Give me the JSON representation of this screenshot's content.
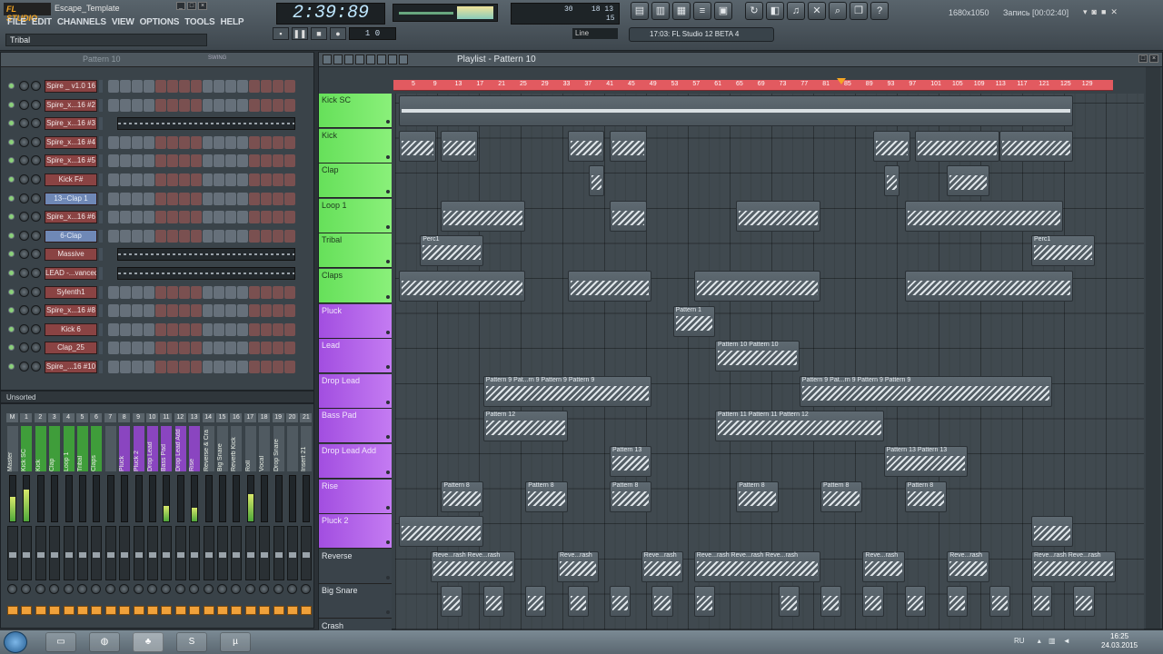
{
  "app": {
    "logo": "FL STUDIO",
    "window_title": "Escape_Template",
    "hint": "Tribal"
  },
  "menu": [
    "FILE",
    "EDIT",
    "CHANNELS",
    "VIEW",
    "OPTIONS",
    "TOOLS",
    "HELP"
  ],
  "transport": {
    "time": "2:39:89",
    "pattern_label": "Pattern 10",
    "pattern_readout": "1 0",
    "snap": "Line"
  },
  "cpu": {
    "cpu_val": "30",
    "mem_val": "18 13",
    "poly_val": "15"
  },
  "news": "17:03: FL Studio 12 BETA 4",
  "recorder": {
    "resolution": "1680x1050",
    "recording": "Запись [00:02:40]"
  },
  "rack": {
    "title": "Pattern 10",
    "swing": "SWING",
    "channels": [
      {
        "name": "Spire _ v1.0 16",
        "style": "red",
        "mode": "steps"
      },
      {
        "name": "Spire_x...16 #2",
        "style": "red",
        "mode": "steps"
      },
      {
        "name": "Spire_x...16 #3",
        "style": "red",
        "mode": "roll"
      },
      {
        "name": "Spire_x...16 #4",
        "style": "red",
        "mode": "steps"
      },
      {
        "name": "Spire_x...16 #5",
        "style": "red",
        "mode": "steps"
      },
      {
        "name": "Kick F#",
        "style": "red",
        "mode": "steps"
      },
      {
        "name": "13--Clap 1",
        "style": "blue",
        "mode": "steps"
      },
      {
        "name": "Spire_x...16 #6",
        "style": "red",
        "mode": "steps"
      },
      {
        "name": "6-Clap",
        "style": "blue",
        "mode": "steps"
      },
      {
        "name": "Massive",
        "style": "red",
        "mode": "roll"
      },
      {
        "name": "LEAD -...vanced",
        "style": "red",
        "mode": "roll"
      },
      {
        "name": "Sylenth1",
        "style": "red",
        "mode": "steps"
      },
      {
        "name": "Spire_x...16 #8",
        "style": "red",
        "mode": "steps"
      },
      {
        "name": "Kick 6",
        "style": "red",
        "mode": "steps"
      },
      {
        "name": "Clap_25",
        "style": "red",
        "mode": "steps"
      },
      {
        "name": "Spire_...16 #10",
        "style": "red",
        "mode": "steps"
      }
    ],
    "filter": "Unsorted"
  },
  "mixer": {
    "tracks": [
      {
        "num": "M",
        "label": "Master",
        "c": "d",
        "level": 0.55
      },
      {
        "num": "1",
        "label": "Kick SC",
        "c": "g",
        "level": 0.7
      },
      {
        "num": "2",
        "label": "Kick",
        "c": "g",
        "level": 0.0
      },
      {
        "num": "3",
        "label": "Clap",
        "c": "g",
        "level": 0.0
      },
      {
        "num": "4",
        "label": "Loop 1",
        "c": "g",
        "level": 0.0
      },
      {
        "num": "5",
        "label": "Tribal",
        "c": "g",
        "level": 0.0
      },
      {
        "num": "6",
        "label": "Claps",
        "c": "g",
        "level": 0.0
      },
      {
        "num": "7",
        "label": "",
        "c": "d",
        "level": 0.0
      },
      {
        "num": "8",
        "label": "Pluck",
        "c": "p",
        "level": 0.0
      },
      {
        "num": "9",
        "label": "Pluck 2",
        "c": "p",
        "level": 0.0
      },
      {
        "num": "10",
        "label": "Drop Lead",
        "c": "p",
        "level": 0.0
      },
      {
        "num": "11",
        "label": "Bass Pad",
        "c": "p",
        "level": 0.35
      },
      {
        "num": "12",
        "label": "Drop Lead Add",
        "c": "p",
        "level": 0.0
      },
      {
        "num": "13",
        "label": "Rise",
        "c": "p",
        "level": 0.3
      },
      {
        "num": "14",
        "label": "Reverse & Cra",
        "c": "d",
        "level": 0.0
      },
      {
        "num": "15",
        "label": "Big Snare",
        "c": "d",
        "level": 0.0
      },
      {
        "num": "16",
        "label": "Reverb Kick",
        "c": "d",
        "level": 0.0
      },
      {
        "num": "17",
        "label": "Roll",
        "c": "d",
        "level": 0.6
      },
      {
        "num": "18",
        "label": "Vocal",
        "c": "d",
        "level": 0.0
      },
      {
        "num": "19",
        "label": "Drop Snare",
        "c": "d",
        "level": 0.0
      },
      {
        "num": "20",
        "label": "",
        "c": "d",
        "level": 0.0
      },
      {
        "num": "21",
        "label": "Insert 21",
        "c": "d",
        "level": 0.0
      }
    ]
  },
  "playlist": {
    "title": "Playlist - Pattern 10",
    "ruler": [
      "5",
      "9",
      "13",
      "17",
      "21",
      "25",
      "29",
      "33",
      "37",
      "41",
      "45",
      "49",
      "53",
      "57",
      "61",
      "65",
      "69",
      "73",
      "77",
      "81",
      "85",
      "89",
      "93",
      "97",
      "101",
      "105",
      "109",
      "113",
      "117",
      "121",
      "125",
      "129"
    ],
    "tracks": [
      {
        "name": "Kick SC",
        "c": "g"
      },
      {
        "name": "Kick",
        "c": "g"
      },
      {
        "name": "Clap",
        "c": "g"
      },
      {
        "name": "Loop 1",
        "c": "g"
      },
      {
        "name": "Tribal",
        "c": "g"
      },
      {
        "name": "Claps",
        "c": "g"
      },
      {
        "name": "Pluck",
        "c": "p"
      },
      {
        "name": "Lead",
        "c": "p"
      },
      {
        "name": "Drop Lead",
        "c": "p"
      },
      {
        "name": "Bass Pad",
        "c": "p"
      },
      {
        "name": "Drop Lead Add",
        "c": "p"
      },
      {
        "name": "Rise",
        "c": "p"
      },
      {
        "name": "Pluck 2",
        "c": "p"
      },
      {
        "name": "Reverse",
        "c": "d"
      },
      {
        "name": "Big Snare",
        "c": "d"
      },
      {
        "name": "Crash",
        "c": "d"
      }
    ],
    "clips": [
      {
        "t": 0,
        "s": 0,
        "l": 128,
        "cap": "",
        "k": "plain"
      },
      {
        "t": 1,
        "s": 0,
        "l": 7,
        "cap": ""
      },
      {
        "t": 1,
        "s": 8,
        "l": 7,
        "cap": ""
      },
      {
        "t": 1,
        "s": 32,
        "l": 7,
        "cap": ""
      },
      {
        "t": 1,
        "s": 40,
        "l": 7,
        "cap": ""
      },
      {
        "t": 1,
        "s": 90,
        "l": 7,
        "cap": ""
      },
      {
        "t": 1,
        "s": 98,
        "l": 16,
        "cap": ""
      },
      {
        "t": 1,
        "s": 114,
        "l": 14,
        "cap": ""
      },
      {
        "t": 2,
        "s": 36,
        "l": 3,
        "cap": ""
      },
      {
        "t": 2,
        "s": 92,
        "l": 3,
        "cap": ""
      },
      {
        "t": 2,
        "s": 104,
        "l": 8,
        "cap": ""
      },
      {
        "t": 3,
        "s": 8,
        "l": 16,
        "cap": ""
      },
      {
        "t": 3,
        "s": 40,
        "l": 7,
        "cap": ""
      },
      {
        "t": 3,
        "s": 64,
        "l": 16,
        "cap": ""
      },
      {
        "t": 3,
        "s": 96,
        "l": 30,
        "cap": ""
      },
      {
        "t": 4,
        "s": 4,
        "l": 12,
        "cap": "Perc1"
      },
      {
        "t": 4,
        "s": 120,
        "l": 12,
        "cap": "Perc1"
      },
      {
        "t": 5,
        "s": 0,
        "l": 24,
        "cap": ""
      },
      {
        "t": 5,
        "s": 32,
        "l": 16,
        "cap": ""
      },
      {
        "t": 5,
        "s": 56,
        "l": 24,
        "cap": ""
      },
      {
        "t": 5,
        "s": 96,
        "l": 32,
        "cap": ""
      },
      {
        "t": 6,
        "s": 52,
        "l": 8,
        "cap": "Pattern 1"
      },
      {
        "t": 7,
        "s": 60,
        "l": 16,
        "cap": "Pattern 10  Pattern 10"
      },
      {
        "t": 8,
        "s": 16,
        "l": 32,
        "cap": "Pattern 9  Pat...rn 9  Pattern 9  Pattern 9"
      },
      {
        "t": 8,
        "s": 76,
        "l": 48,
        "cap": "Pattern 9  Pat...rn 9  Pattern 9  Pattern 9"
      },
      {
        "t": 9,
        "s": 16,
        "l": 16,
        "cap": "Pattern 12"
      },
      {
        "t": 9,
        "s": 60,
        "l": 32,
        "cap": "Pattern 11  Pattern 11  Pattern 12"
      },
      {
        "t": 10,
        "s": 40,
        "l": 8,
        "cap": "Pattern 13"
      },
      {
        "t": 10,
        "s": 92,
        "l": 16,
        "cap": "Pattern 13  Pattern 13"
      },
      {
        "t": 11,
        "s": 8,
        "l": 8,
        "cap": "Pattern 8"
      },
      {
        "t": 11,
        "s": 24,
        "l": 8,
        "cap": "Pattern 8"
      },
      {
        "t": 11,
        "s": 40,
        "l": 8,
        "cap": "Pattern 8"
      },
      {
        "t": 11,
        "s": 64,
        "l": 8,
        "cap": "Pattern 8"
      },
      {
        "t": 11,
        "s": 80,
        "l": 8,
        "cap": "Pattern 8"
      },
      {
        "t": 11,
        "s": 96,
        "l": 8,
        "cap": "Pattern 8"
      },
      {
        "t": 12,
        "s": 0,
        "l": 16,
        "cap": ""
      },
      {
        "t": 12,
        "s": 120,
        "l": 8,
        "cap": ""
      },
      {
        "t": 13,
        "s": 6,
        "l": 16,
        "cap": "Reve...rash  Reve...rash"
      },
      {
        "t": 13,
        "s": 30,
        "l": 8,
        "cap": "Reve...rash"
      },
      {
        "t": 13,
        "s": 46,
        "l": 8,
        "cap": "Reve...rash"
      },
      {
        "t": 13,
        "s": 56,
        "l": 24,
        "cap": "Reve...rash  Reve...rash  Reve...rash"
      },
      {
        "t": 13,
        "s": 88,
        "l": 8,
        "cap": "Reve...rash"
      },
      {
        "t": 13,
        "s": 104,
        "l": 8,
        "cap": "Reve...rash"
      },
      {
        "t": 13,
        "s": 120,
        "l": 16,
        "cap": "Reve...rash  Reve...rash"
      },
      {
        "t": 14,
        "s": 8,
        "l": 4,
        "cap": ""
      },
      {
        "t": 14,
        "s": 16,
        "l": 4,
        "cap": ""
      },
      {
        "t": 14,
        "s": 24,
        "l": 4,
        "cap": ""
      },
      {
        "t": 14,
        "s": 32,
        "l": 4,
        "cap": ""
      },
      {
        "t": 14,
        "s": 40,
        "l": 4,
        "cap": ""
      },
      {
        "t": 14,
        "s": 48,
        "l": 4,
        "cap": ""
      },
      {
        "t": 14,
        "s": 56,
        "l": 4,
        "cap": ""
      },
      {
        "t": 14,
        "s": 72,
        "l": 4,
        "cap": ""
      },
      {
        "t": 14,
        "s": 80,
        "l": 4,
        "cap": ""
      },
      {
        "t": 14,
        "s": 88,
        "l": 4,
        "cap": ""
      },
      {
        "t": 14,
        "s": 96,
        "l": 4,
        "cap": ""
      },
      {
        "t": 14,
        "s": 104,
        "l": 4,
        "cap": ""
      },
      {
        "t": 14,
        "s": 112,
        "l": 4,
        "cap": ""
      },
      {
        "t": 14,
        "s": 120,
        "l": 4,
        "cap": ""
      },
      {
        "t": 14,
        "s": 128,
        "l": 4,
        "cap": ""
      }
    ]
  },
  "taskbar": {
    "lang": "RU",
    "time": "16:25",
    "date": "24.03.2015"
  }
}
